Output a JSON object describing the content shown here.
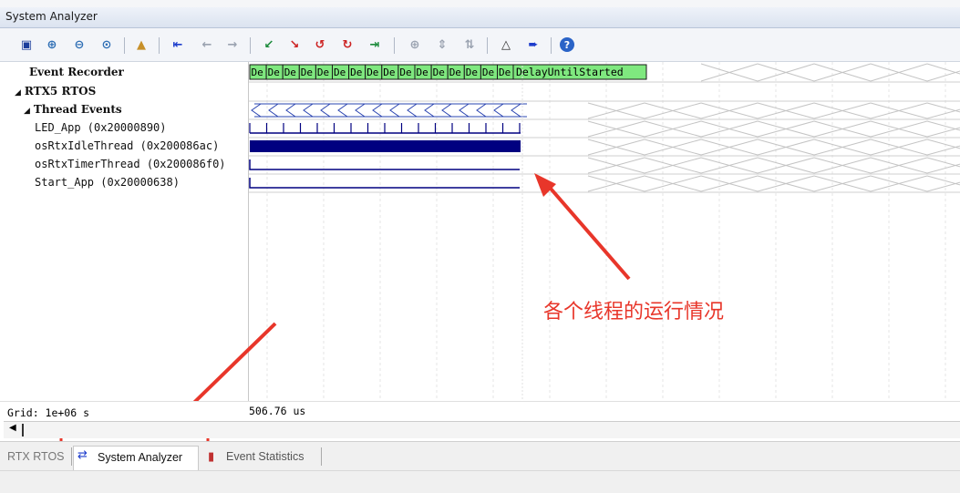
{
  "window": {
    "title": "System Analyzer"
  },
  "toolbar": {
    "icons": [
      "save-icon",
      "zoom-in-icon",
      "zoom-out-icon",
      "zoom-all-icon",
      "lock-icon",
      "jump-start-icon",
      "prev-icon",
      "next-icon",
      "prev-event-icon",
      "next-event-icon",
      "prev-error-icon",
      "next-error-icon",
      "jump-end-icon",
      "cursor-icon",
      "code-icon",
      "marker-icon",
      "delta-icon",
      "go-end-icon",
      "help-icon"
    ]
  },
  "tree": {
    "event_recorder": "Event Recorder",
    "rtx5": "RTX5 RTOS",
    "thread_events": "Thread Events",
    "threads": [
      {
        "label": "LED_App (0x20000890)"
      },
      {
        "label": "osRtxIdleThread (0x200086ac)"
      },
      {
        "label": "osRtxTimerThread (0x200086f0)"
      },
      {
        "label": "Start_App (0x20000638)"
      }
    ]
  },
  "timeline": {
    "event_cells": [
      "De",
      "De",
      "De",
      "De",
      "De",
      "De",
      "De",
      "De",
      "De",
      "De",
      "De",
      "De",
      "De",
      "De",
      "De",
      "De"
    ],
    "last_event": "DelayUntilStarted",
    "grid_label": "Grid: 1e+06 s",
    "time_label": "506.76 us"
  },
  "tabs": [
    {
      "label": "RTX RTOS"
    },
    {
      "label": "System Analyzer"
    },
    {
      "label": "Event Statistics"
    }
  ],
  "annotation": {
    "text": "各个线程的运行情况"
  },
  "colors": {
    "event_green": "#7fe87f",
    "bar_navy": "#000080",
    "annotation_red": "#e8362a"
  }
}
